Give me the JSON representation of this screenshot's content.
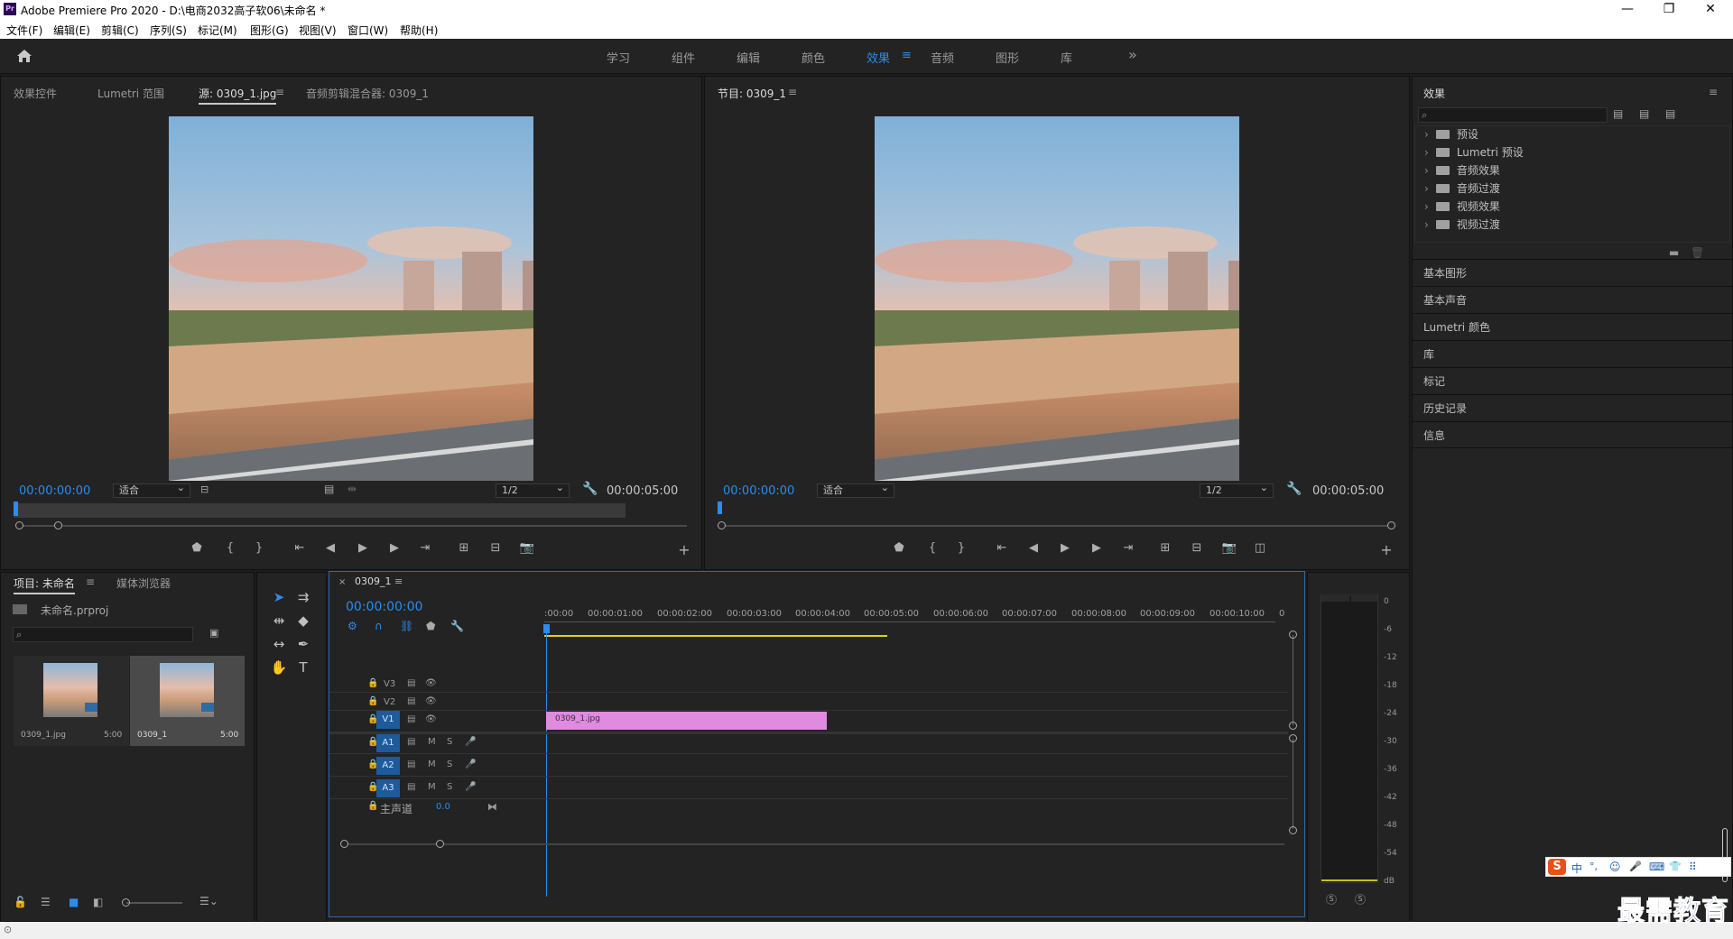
{
  "window": {
    "title": "Adobe Premiere Pro 2020 - D:\\电商2032高子软06\\未命名 *",
    "app_icon": "Pr",
    "minimize": "—",
    "restore": "❐",
    "close": "✕"
  },
  "menu": [
    "文件(F)",
    "编辑(E)",
    "剪辑(C)",
    "序列(S)",
    "标记(M)",
    "图形(G)",
    "视图(V)",
    "窗口(W)",
    "帮助(H)"
  ],
  "workspaces": {
    "items": [
      "学习",
      "组件",
      "编辑",
      "颜色",
      "效果",
      "音频",
      "图形",
      "库"
    ],
    "active": "效果",
    "more": "»"
  },
  "source_panel": {
    "tabs": [
      "效果控件",
      "Lumetri 范围",
      "源: 0309_1.jpg",
      "音频剪辑混合器: 0309_1"
    ],
    "active_tab": "源: 0309_1.jpg",
    "timecode": "00:00:00:00",
    "fit": "适合",
    "resolution": "1/2",
    "duration": "00:00:05:00"
  },
  "program_panel": {
    "title": "节目: 0309_1",
    "timecode": "00:00:00:00",
    "fit": "适合",
    "resolution": "1/2",
    "duration": "00:00:05:00"
  },
  "effects_panel": {
    "title": "效果",
    "tree": [
      "预设",
      "Lumetri 预设",
      "音频效果",
      "音频过渡",
      "视频效果",
      "视频过渡"
    ],
    "sections": [
      "基本图形",
      "基本声音",
      "Lumetri 颜色",
      "库",
      "标记",
      "历史记录",
      "信息"
    ]
  },
  "project_panel": {
    "tabs": [
      "项目: 未命名",
      "媒体浏览器"
    ],
    "project_file": "未命名.prproj",
    "items": [
      {
        "name": "0309_1.jpg",
        "duration": "5:00"
      },
      {
        "name": "0309_1",
        "duration": "5:00"
      }
    ]
  },
  "timeline": {
    "sequence_tab": "0309_1",
    "timecode": "00:00:00:00",
    "ruler": [
      ":00:00",
      "00:00:01:00",
      "00:00:02:00",
      "00:00:03:00",
      "00:00:04:00",
      "00:00:05:00",
      "00:00:06:00",
      "00:00:07:00",
      "00:00:08:00",
      "00:00:09:00",
      "00:00:10:00",
      "0"
    ],
    "video_tracks": [
      "V3",
      "V2",
      "V1"
    ],
    "audio_tracks": [
      "A1",
      "A2",
      "A3"
    ],
    "master_label": "主声道",
    "master_value": "0.0",
    "clip_name": "0309_1.jpg",
    "mute": "M",
    "solo": "S"
  },
  "meter": {
    "labels": [
      "0",
      "-6",
      "-12",
      "-18",
      "-24",
      "-30",
      "-36",
      "-42",
      "-48",
      "-54",
      "dB"
    ],
    "solo_buttons": [
      "S",
      "S"
    ]
  },
  "ime": {
    "items": [
      "中",
      "°,",
      "☺",
      "🎤",
      "⌨",
      "👕",
      "⠿"
    ]
  },
  "watermark": "最需教育",
  "colors": {
    "accent": "#2d8ceb",
    "clip": "#e08ae0",
    "track_badge": "#1f5a9a"
  }
}
